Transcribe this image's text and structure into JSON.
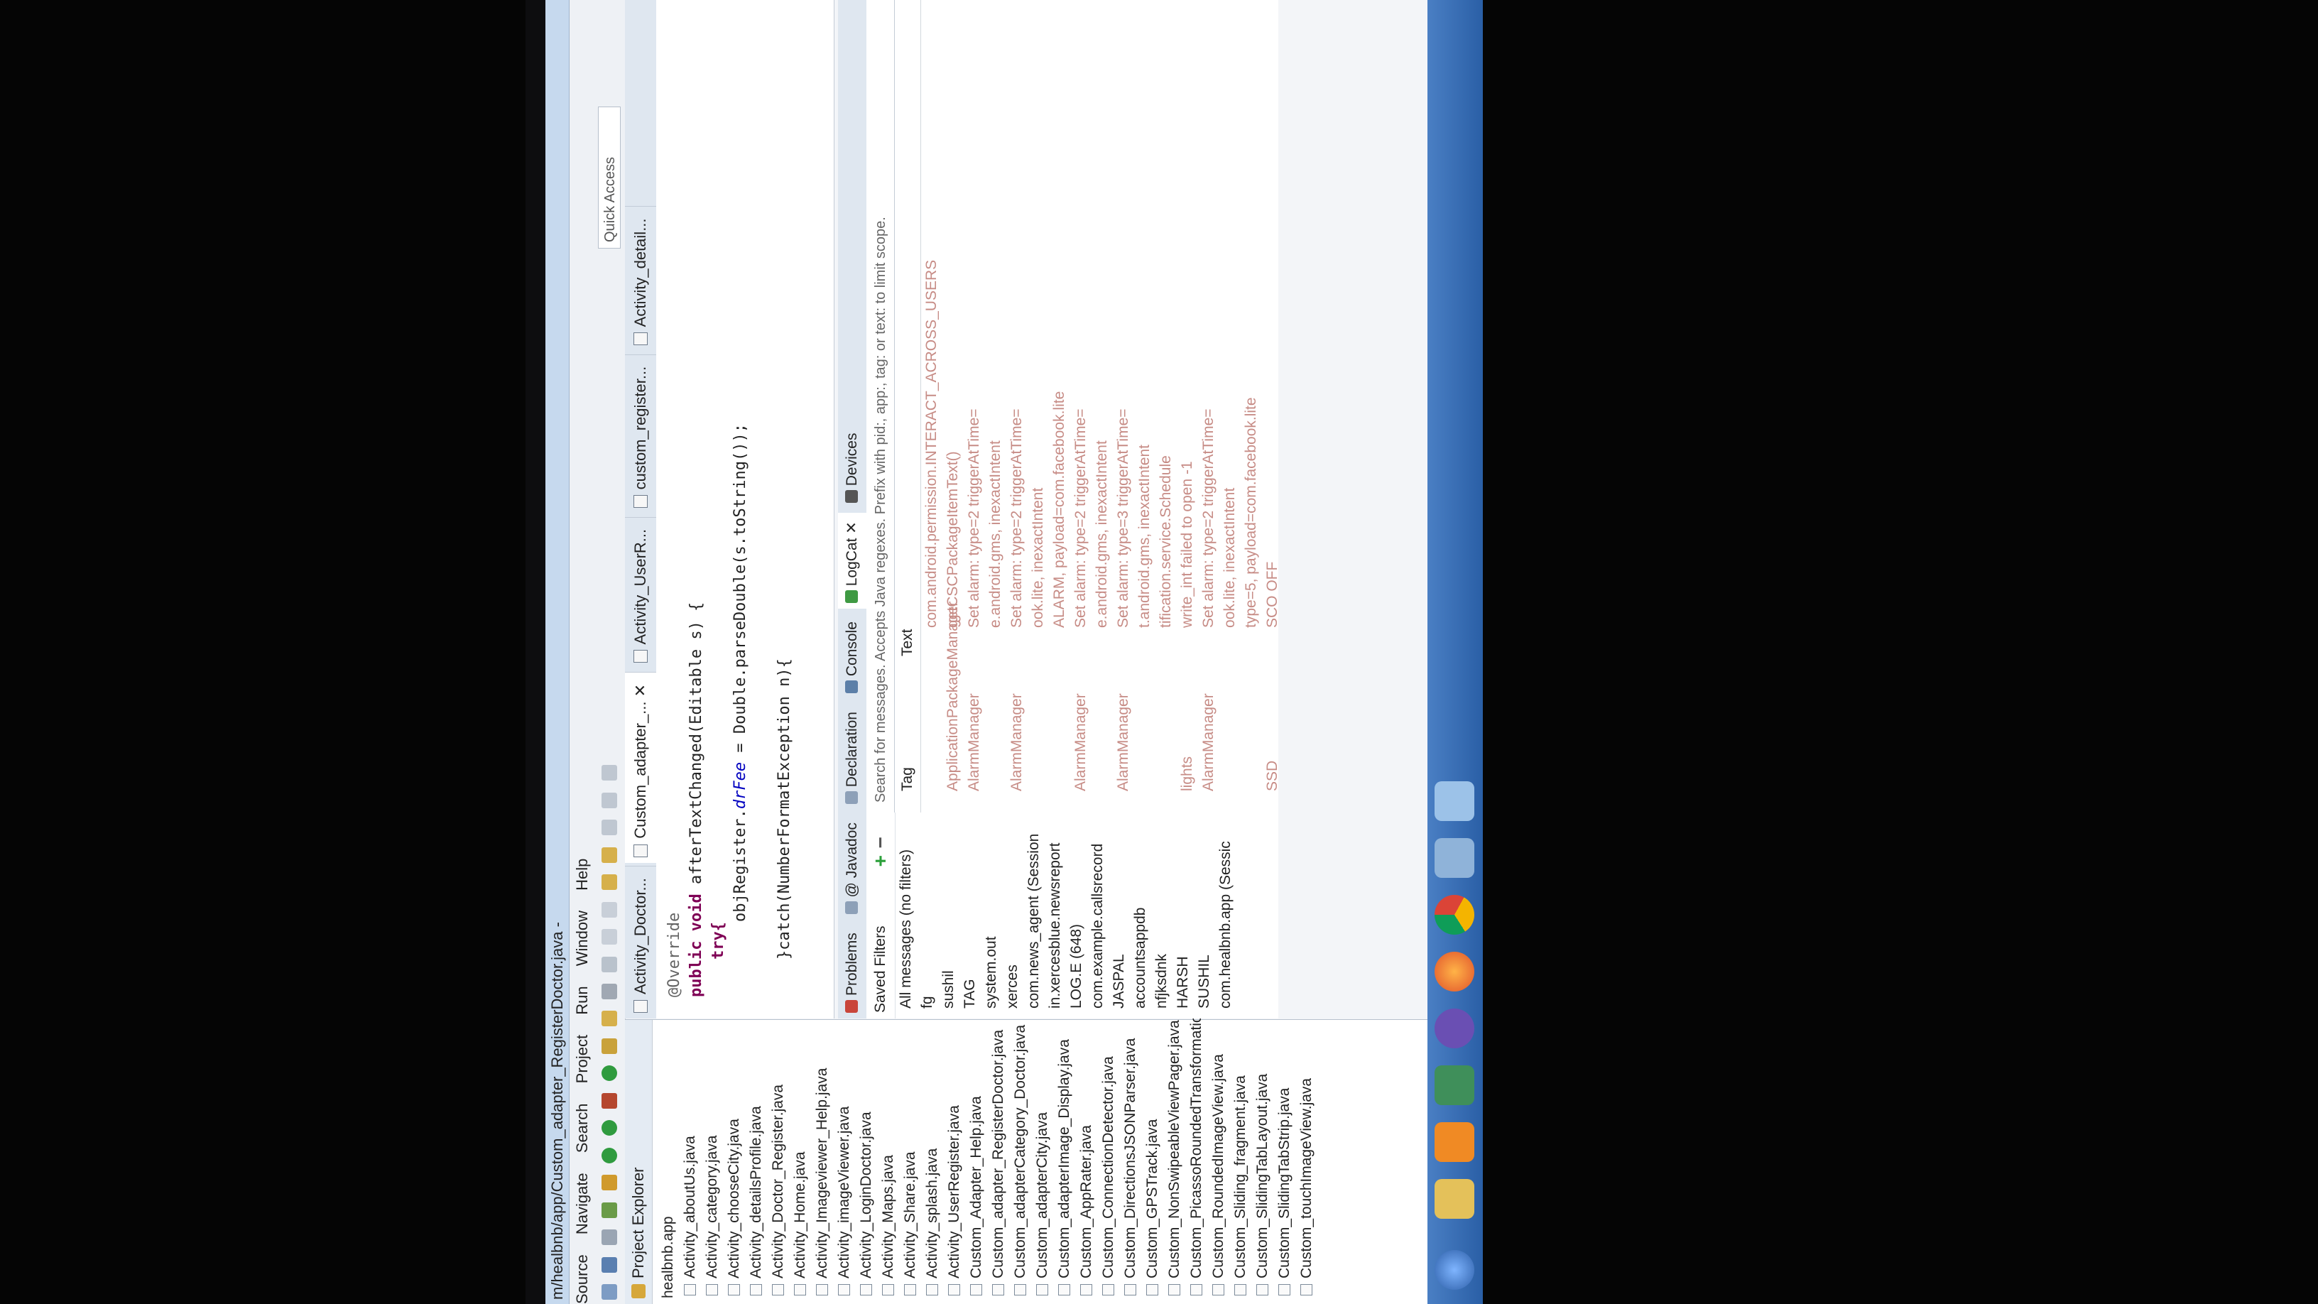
{
  "window": {
    "title": "m/healbnb/app/Custom_adapter_RegisterDoctor.java -"
  },
  "menu": [
    "Source",
    "Navigate",
    "Search",
    "Project",
    "Run",
    "Window",
    "Help"
  ],
  "quick_access": "Quick Access",
  "project_explorer": {
    "tab_label": "Project Explorer",
    "root": "healbnb.app",
    "files": [
      "Activity_aboutUs.java",
      "Activity_category.java",
      "Activity_chooseCity.java",
      "Activity_detailsProfile.java",
      "Activity_Doctor_Register.java",
      "Activity_Home.java",
      "Activity_Imageviewer_Help.java",
      "Activity_imageViewer.java",
      "Activity_LoginDoctor.java",
      "Activity_Maps.java",
      "Activity_Share.java",
      "Activity_splash.java",
      "Activity_UserRegister.java",
      "Custom_Adapter_Help.java",
      "Custom_adapter_RegisterDoctor.java",
      "Custom_adapterCategory_Doctor.java",
      "Custom_adapterCity.java",
      "Custom_adapterImage_Display.java",
      "Custom_AppRater.java",
      "Custom_ConnectionDetector.java",
      "Custom_DirectionsJSONParser.java",
      "Custom_GPSTrack.java",
      "Custom_NonSwipeableViewPager.java",
      "Custom_PicassoRoundedTransformation",
      "Custom_RoundedImageView.java",
      "Custom_Sliding_fragment.java",
      "Custom_SlidingTabLayout.java",
      "Custom_SlidingTabStrip.java",
      "Custom_touchImageView.java"
    ]
  },
  "editor_tabs": [
    "Activity_Doctor...",
    "Custom_adapter_...",
    "Activity_UserR...",
    "custom_register...",
    "Activity_detail..."
  ],
  "code": {
    "l1": "@Override",
    "l2a": "public void",
    "l2b": " afterTextChanged(Editable s) {",
    "l3": "try{",
    "l4a": "objRegister.",
    "l4b": "drFee",
    "l4c": " = Double.parseDouble(s.toString());",
    "l5": "}catch(NumberFormatException n){"
  },
  "bottom_tabs": [
    "Problems",
    "@ Javadoc",
    "Declaration",
    "Console",
    "LogCat",
    "Devices"
  ],
  "logcat": {
    "saved_filters": "Saved Filters",
    "search_placeholder": "Search for messages. Accepts Java regexes. Prefix with pid:, app:, tag: or text: to limit scope.",
    "col_tag": "Tag",
    "col_text": "Text",
    "filters": [
      "All messages (no filters)",
      "fg",
      "sushil",
      "TAG",
      "system.out",
      "xerces",
      "com.news_agent (Session",
      "in.xercesblue.newsreport",
      "LOG.E (648)",
      "com.example.callsrecord",
      "JASPAL",
      "accountsappdb",
      "nfjksdnk",
      "HARSH",
      "SUSHIL",
      "com.healbnb.app (Sessic"
    ],
    "rows": [
      {
        "tag": "",
        "text": "com.android.permission.INTERACT_ACROSS_USERS"
      },
      {
        "tag": "ApplicationPackageManager",
        "text": "getCSCPackageItemText()"
      },
      {
        "tag": "AlarmManager",
        "text": "Set alarm: type=2 triggerAtTime="
      },
      {
        "tag": "",
        "text": "e.android.gms, inexactIntent"
      },
      {
        "tag": "AlarmManager",
        "text": "Set alarm: type=2 triggerAtTime="
      },
      {
        "tag": "",
        "text": "ook.lite, inexactIntent"
      },
      {
        "tag": "",
        "text": "ALARM, payload=com.facebook.lite"
      },
      {
        "tag": "AlarmManager",
        "text": "Set alarm: type=2 triggerAtTime="
      },
      {
        "tag": "",
        "text": "e.android.gms, inexactIntent"
      },
      {
        "tag": "AlarmManager",
        "text": "Set alarm: type=3 triggerAtTime="
      },
      {
        "tag": "",
        "text": "t.android.gms, inexactIntent"
      },
      {
        "tag": "",
        "text": "tification.service.Schedule"
      },
      {
        "tag": "lights",
        "text": "write_int failed to open -1"
      },
      {
        "tag": "AlarmManager",
        "text": "Set alarm: type=2 triggerAtTime="
      },
      {
        "tag": "",
        "text": "ook.lite, inexactIntent"
      },
      {
        "tag": "",
        "text": "type=5, payload=com.facebook.lite"
      },
      {
        "tag": "SSD",
        "text": "SCO OFF"
      }
    ]
  },
  "colors": {
    "title_bar": "#c6d9ee",
    "log_text": "#c78c86",
    "keyword": "#7f0055",
    "field": "#0000c0",
    "taskbar": "#2a5fa6"
  },
  "icons": [
    "file-icon",
    "save-icon",
    "run-icon",
    "debug-icon",
    "search-icon",
    "chrome-icon",
    "firefox-icon"
  ]
}
